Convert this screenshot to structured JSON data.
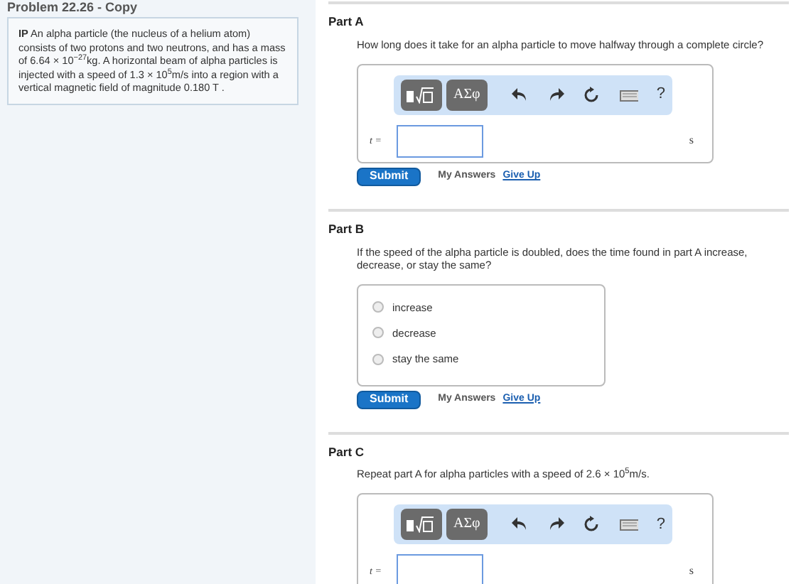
{
  "problem": {
    "title": "Problem 22.26 - Copy",
    "statement": "**IP** An alpha particle (the nucleus of a helium atom) consists of two protons and two neutrons, and has a mass of 6.64 × 10$^{−27}$kg. A horizontal beam of alpha particles is injected with a speed of 1.3 × 10$^{5}$m/s into a region with a vertical magnetic field of magnitude 0.180 T ."
  },
  "parts": [
    {
      "kind": "numeric",
      "title": "Part A",
      "question": "How long does it take for an alpha particle to move halfway through a complete circle?",
      "symbols": "ΑΣφ",
      "help": "?",
      "variable": "t =",
      "unit": "s",
      "submit": "Submit",
      "my_answers": "My Answers",
      "give_up": "Give Up"
    },
    {
      "kind": "choice",
      "title": "Part B",
      "question": "If the speed of the alpha particle is doubled, does the time found in part A increase, decrease, or stay the same?",
      "options": [
        {
          "label": "increase",
          "selected": false
        },
        {
          "label": "decrease",
          "selected": false
        },
        {
          "label": "stay the same",
          "selected": false
        }
      ],
      "submit": "Submit",
      "my_answers": "My Answers",
      "give_up": "Give Up"
    },
    {
      "kind": "numeric",
      "title": "Part C",
      "question": "Repeat part A for alpha particles with a speed of 2.6 × 10$^{5}$m/s.",
      "symbols": "ΑΣφ",
      "help": "?",
      "variable": "t =",
      "unit": "s"
    }
  ]
}
